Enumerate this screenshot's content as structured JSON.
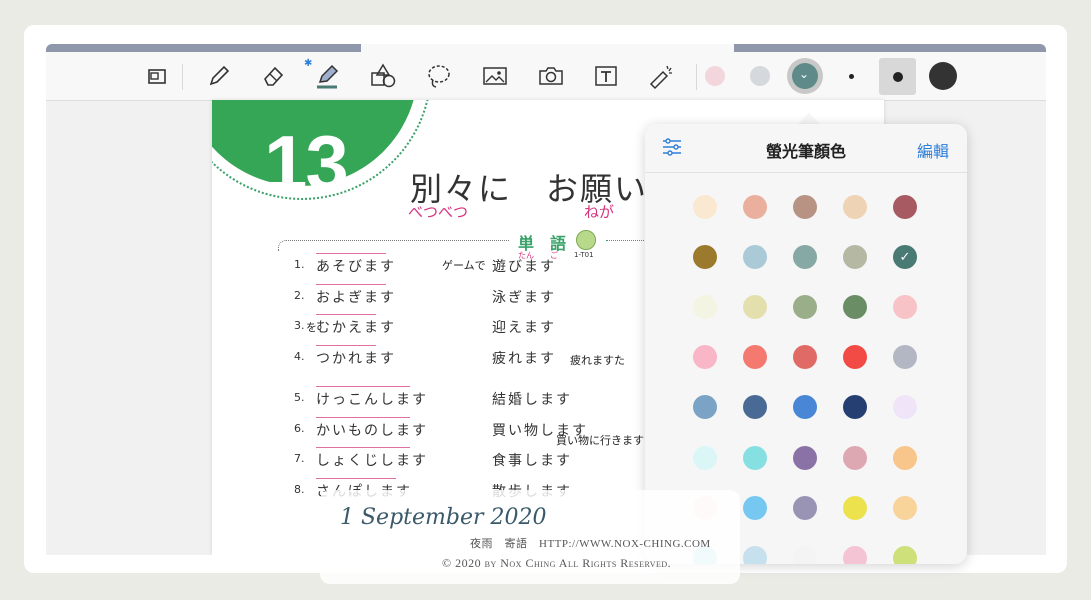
{
  "toolbar": {
    "bluetooth": "✱",
    "tools": [
      "thumbnails-icon",
      "pen-icon",
      "eraser-icon",
      "highlighter-icon",
      "shapes-icon",
      "lasso-icon",
      "image-icon",
      "camera-icon",
      "textbox-icon",
      "laser-pointer-icon"
    ],
    "quick_colors": [
      "#f3d6dc",
      "#d5d8dd",
      "#5e8a8a"
    ],
    "sizes": [
      "small",
      "medium",
      "large"
    ]
  },
  "document": {
    "lesson_number": "13",
    "title": "別々に　お願い",
    "title_furigana_1": "べつべつ",
    "title_furigana_2": "ねが",
    "section_label": "単　語",
    "section_furigana": "たん　　ご",
    "track": "1-T01",
    "vocab": [
      {
        "num": "1.",
        "word": "あそびます",
        "verb": "遊びます",
        "note": "ゲームで"
      },
      {
        "num": "2.",
        "word": "およぎます",
        "verb": "泳ぎます",
        "note": ""
      },
      {
        "num": "3.",
        "word": "むかえます",
        "verb": "迎えます",
        "note": "を"
      },
      {
        "num": "4.",
        "word": "つかれます",
        "verb": "疲れます",
        "note": "疲れますた"
      },
      {
        "num": "5.",
        "word": "けっこんします",
        "verb": "結婚します",
        "note": ""
      },
      {
        "num": "6.",
        "word": "かいものします",
        "verb": "買い物します",
        "note": "買い物に行きます"
      },
      {
        "num": "7.",
        "word": "しょくじします",
        "verb": "食事します",
        "note": ""
      },
      {
        "num": "8.",
        "word": "さんぽします",
        "verb": "散歩します",
        "note": ""
      }
    ]
  },
  "popover": {
    "title": "螢光筆顏色",
    "edit": "編輯",
    "selected": "#4a7a74",
    "colors": [
      [
        "#fbe8d0",
        "#eab09d",
        "#b89384",
        "#eed3b4",
        "#a85a62"
      ],
      [
        "#9b7a2e",
        "#a9cad6",
        "#86a9a6",
        "#b5b8a3",
        "#4a7a74"
      ],
      [
        "#f4f4e2",
        "#e4e0ae",
        "#9aae8a",
        "#6a8d66",
        "#f8c3c6"
      ],
      [
        "#f8b6c6",
        "#f47a70",
        "#e06a66",
        "#f24a44",
        "#b2b7c3"
      ],
      [
        "#7aa3c6",
        "#4a6a96",
        "#4a86d6",
        "#263f73",
        "#efe4f8"
      ],
      [
        "#daf6f6",
        "#86dfe1",
        "#8a72a6",
        "#dea8b3",
        "#f8c68a"
      ],
      [
        "#fde1e1",
        "#76c8f0",
        "#9a94b4",
        "#ece24e",
        "#f8d39a"
      ],
      [
        "#b6e6ea",
        "#c7e0ee",
        "#f4f4f4",
        "#f4c4d4",
        "#cde07a"
      ]
    ]
  },
  "watermark": {
    "date": "1 September 2020",
    "line": "夜雨　寄語　HTTP://WWW.NOX-CHING.COM",
    "copyright": "© 2020 by Nox Ching All Rights Reserved."
  }
}
